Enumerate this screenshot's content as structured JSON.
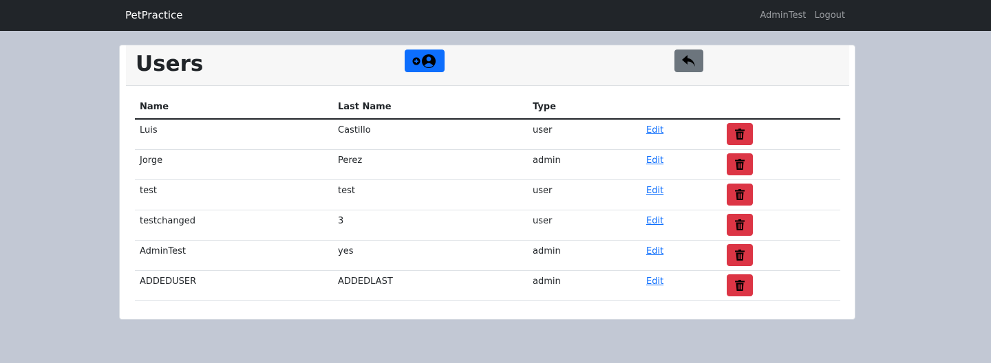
{
  "navbar": {
    "brand": "PetPractice",
    "username": "AdminTest",
    "logout_label": "Logout"
  },
  "header": {
    "title": "Users",
    "add_button_icon": "add-user-icon",
    "back_button_icon": "reply-arrow-icon"
  },
  "table": {
    "columns": [
      "Name",
      "Last Name",
      "Type"
    ],
    "edit_label": "Edit",
    "delete_icon": "trash-icon",
    "rows": [
      {
        "name": "Luis",
        "last_name": "Castillo",
        "type": "user"
      },
      {
        "name": "Jorge",
        "last_name": "Perez",
        "type": "admin"
      },
      {
        "name": "test",
        "last_name": "test",
        "type": "user"
      },
      {
        "name": "testchanged",
        "last_name": "3",
        "type": "user"
      },
      {
        "name": "AdminTest",
        "last_name": "yes",
        "type": "admin"
      },
      {
        "name": "ADDEDUSER",
        "last_name": "ADDEDLAST",
        "type": "admin"
      }
    ]
  },
  "colors": {
    "navbar": "#212529",
    "primary": "#0d6efd",
    "secondary": "#6c757d",
    "danger": "#dc3545",
    "page_background": "#c2c8d4"
  }
}
